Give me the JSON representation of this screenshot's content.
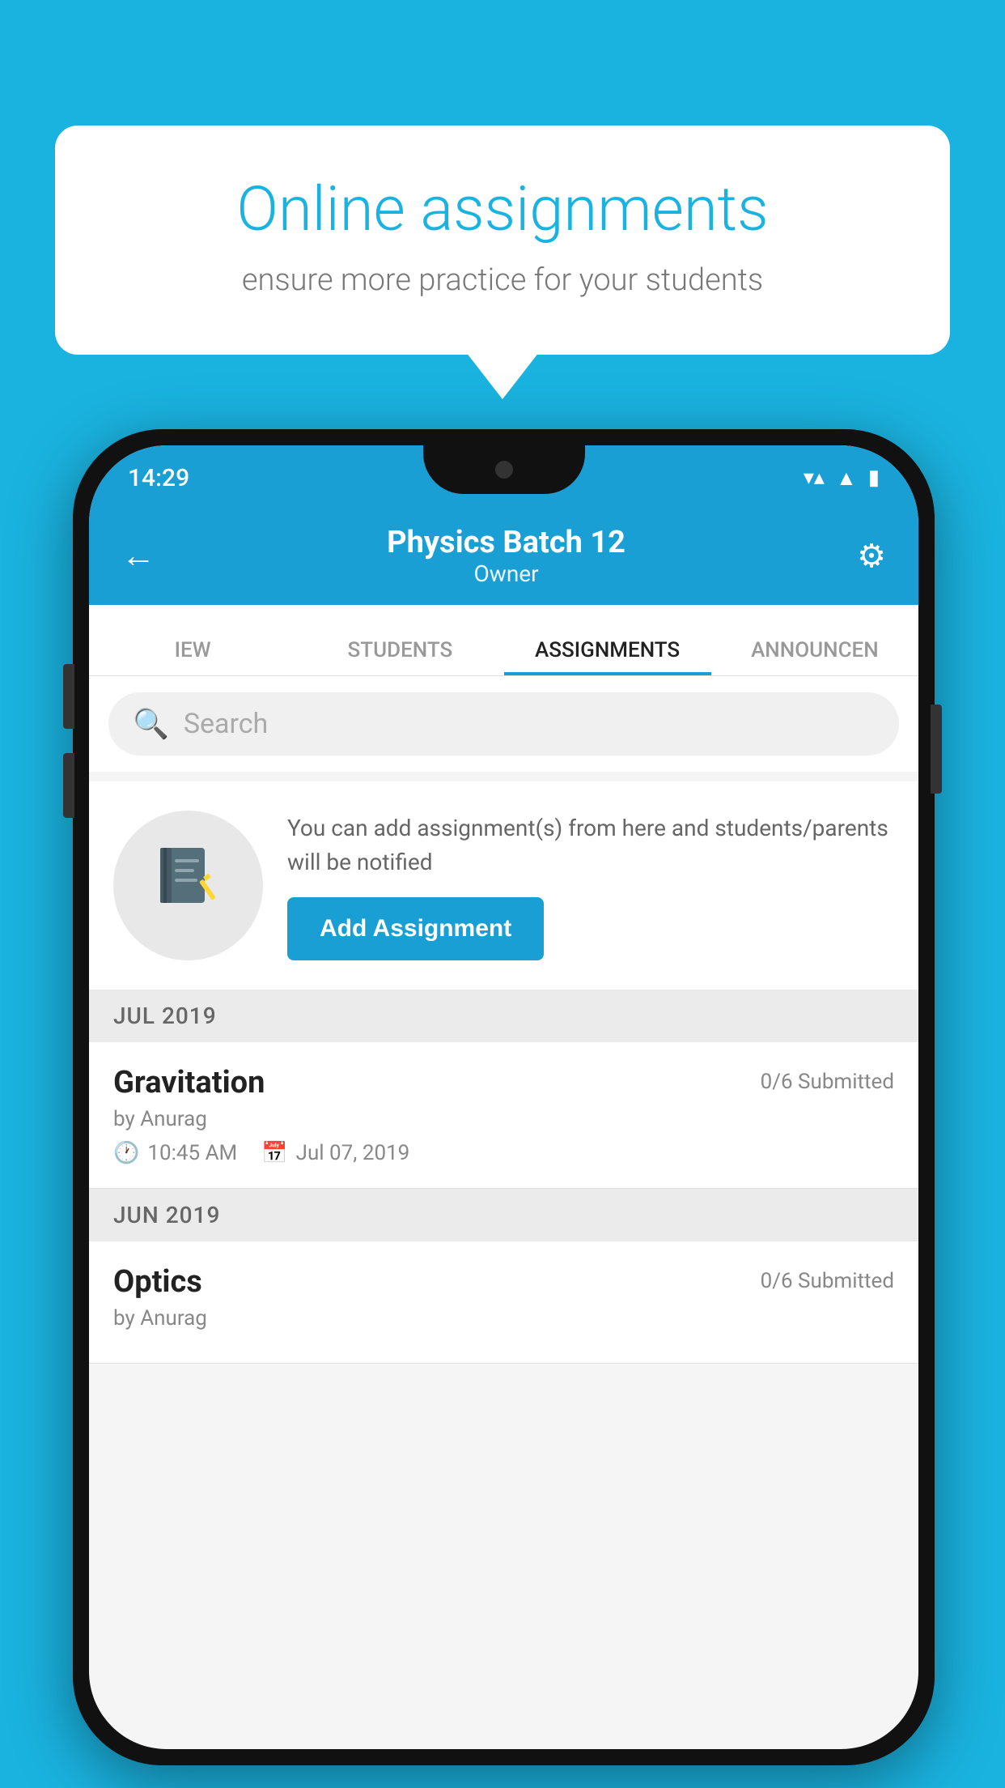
{
  "background_color": "#1ab3e0",
  "speech_bubble": {
    "title": "Online assignments",
    "subtitle": "ensure more practice for your students"
  },
  "status_bar": {
    "time": "14:29",
    "wifi": "▼",
    "signal": "▲",
    "battery": "▮"
  },
  "header": {
    "title": "Physics Batch 12",
    "subtitle": "Owner",
    "back_label": "←",
    "settings_label": "⚙"
  },
  "tabs": [
    {
      "label": "IEW",
      "active": false
    },
    {
      "label": "STUDENTS",
      "active": false
    },
    {
      "label": "ASSIGNMENTS",
      "active": true
    },
    {
      "label": "ANNOUNCEN",
      "active": false
    }
  ],
  "search": {
    "placeholder": "Search"
  },
  "add_assignment": {
    "description": "You can add assignment(s) from here and students/parents will be notified",
    "button_label": "Add Assignment"
  },
  "sections": [
    {
      "label": "JUL 2019",
      "assignments": [
        {
          "name": "Gravitation",
          "submitted": "0/6 Submitted",
          "author": "by Anurag",
          "time": "10:45 AM",
          "date": "Jul 07, 2019"
        }
      ]
    },
    {
      "label": "JUN 2019",
      "assignments": [
        {
          "name": "Optics",
          "submitted": "0/6 Submitted",
          "author": "by Anurag",
          "time": "",
          "date": ""
        }
      ]
    }
  ]
}
